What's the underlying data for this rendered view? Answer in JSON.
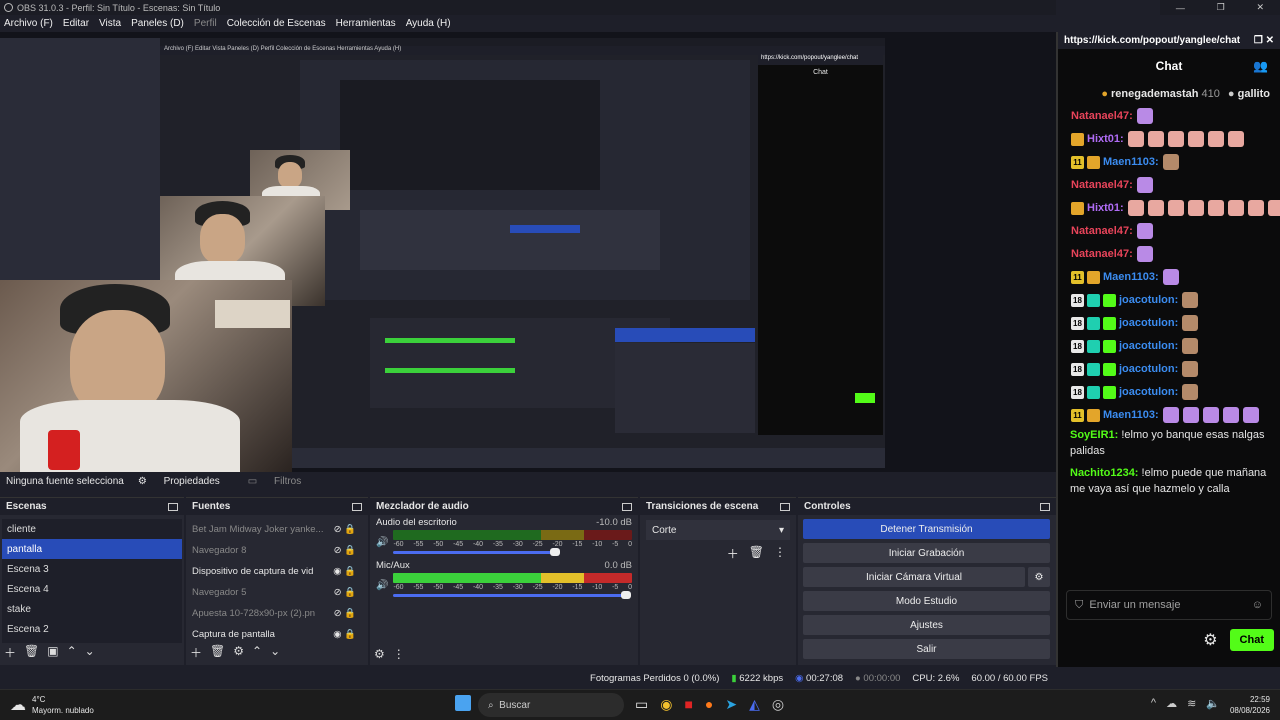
{
  "window": {
    "title": "OBS 31.0.3 - Perfil: Sin Título - Escenas: Sin Título"
  },
  "menu": [
    "Archivo (F)",
    "Editar",
    "Vista",
    "Paneles (D)",
    "Perfil",
    "Colección de Escenas",
    "Herramientas",
    "Ayuda (H)"
  ],
  "source_bar": {
    "label": "Ninguna fuente selecciona",
    "properties": "Propiedades",
    "filters": "Filtros"
  },
  "docks": {
    "scenes": {
      "title": "Escenas",
      "items": [
        "cliente",
        "pantalla",
        "Escena 3",
        "Escena 4",
        "stake",
        "Escena 2"
      ],
      "selected": "pantalla"
    },
    "sources": {
      "title": "Fuentes",
      "items": [
        "Bet Jam Midway Joker yanke...",
        "Navegador 8",
        "Dispositivo de captura de vid",
        "Navegador 5",
        "Apuesta 10-728x90-px (2).pn",
        "Captura de pantalla"
      ]
    },
    "mixer": {
      "title": "Mezclador de audio",
      "tracks": [
        {
          "name": "Audio del escritorio",
          "db": "-10.0 dB",
          "level": 0.55
        },
        {
          "name": "Mic/Aux",
          "db": "0.0 dB",
          "level": 0.99
        }
      ],
      "ticks": [
        "-60",
        "-55",
        "-50",
        "-45",
        "-40",
        "-35",
        "-30",
        "-25",
        "-20",
        "-15",
        "-10",
        "-5",
        "0"
      ]
    },
    "transitions": {
      "title": "Transiciones de escena",
      "selected": "Corte"
    },
    "controls": {
      "title": "Controles",
      "buttons": [
        "Detener Transmisión",
        "Iniciar Grabación",
        "Iniciar Cámara Virtual",
        "Modo Estudio",
        "Ajustes",
        "Salir"
      ]
    }
  },
  "status": {
    "dropped": "Fotogramas Perdidos 0 (0.0%)",
    "bitrate": "6222 kbps",
    "stream_time": "00:27:08",
    "rec_time": "00:00:00",
    "cpu": "CPU: 2.6%",
    "fps": "60.00 / 60.00 FPS"
  },
  "kick": {
    "url": "https://kick.com/popout/yanglee/chat",
    "title": "Chat",
    "top_gifters": [
      {
        "name": "renegademastah",
        "count": "410"
      },
      {
        "name": "gallito"
      }
    ],
    "messages": [
      {
        "user": "Natanael47",
        "color": "#e8445a",
        "badges": [],
        "emotes": [
          "purple"
        ]
      },
      {
        "user": "Hixt01",
        "color": "#b06cf5",
        "badges": [
          "crown"
        ],
        "emotes": [
          "pink",
          "pink",
          "pink",
          "pink",
          "pink",
          "pink"
        ]
      },
      {
        "user": "Maen1103",
        "color": "#3b8cf0",
        "badges": [
          "11",
          "crown"
        ],
        "emotes": [
          "face"
        ]
      },
      {
        "user": "Natanael47",
        "color": "#e8445a",
        "badges": [],
        "emotes": [
          "purple"
        ]
      },
      {
        "user": "Hixt01",
        "color": "#b06cf5",
        "badges": [
          "crown"
        ],
        "emotes": [
          "pink",
          "pink",
          "pink",
          "pink",
          "pink",
          "pink",
          "pink",
          "pink"
        ]
      },
      {
        "user": "Natanael47",
        "color": "#e8445a",
        "badges": [],
        "emotes": [
          "purple"
        ]
      },
      {
        "user": "Natanael47",
        "color": "#e8445a",
        "badges": [],
        "emotes": [
          "purple"
        ]
      },
      {
        "user": "Maen1103",
        "color": "#3b8cf0",
        "badges": [
          "11",
          "crown"
        ],
        "emotes": [
          "purple"
        ]
      },
      {
        "user": "joacotulon",
        "color": "#3b8cf0",
        "badges": [
          "18",
          "gift",
          "green"
        ],
        "emotes": [
          "face"
        ]
      },
      {
        "user": "joacotulon",
        "color": "#3b8cf0",
        "badges": [
          "18",
          "gift",
          "green"
        ],
        "emotes": [
          "face"
        ]
      },
      {
        "user": "joacotulon",
        "color": "#3b8cf0",
        "badges": [
          "18",
          "gift",
          "green"
        ],
        "emotes": [
          "face"
        ]
      },
      {
        "user": "joacotulon",
        "color": "#3b8cf0",
        "badges": [
          "18",
          "gift",
          "green"
        ],
        "emotes": [
          "face"
        ]
      },
      {
        "user": "joacotulon",
        "color": "#3b8cf0",
        "badges": [
          "18",
          "gift",
          "green"
        ],
        "emotes": [
          "face"
        ]
      },
      {
        "user": "Maen1103",
        "color": "#3b8cf0",
        "badges": [
          "11",
          "crown"
        ],
        "emotes": [
          "purple",
          "purple",
          "purple",
          "purple",
          "purple"
        ]
      }
    ],
    "text_messages": [
      {
        "user": "SoyEIR1",
        "color": "#53fc18",
        "text": "!elmo yo banque esas nalgas palidas"
      },
      {
        "user": "Nachito1234",
        "color": "#53fc18",
        "text": "!elmo puede que mañana me vaya así que hazmelo y calla"
      }
    ],
    "input_placeholder": "Enviar un mensaje",
    "send_label": "Chat"
  },
  "taskbar": {
    "temp": "4°C",
    "weather": "Mayorm. nublado",
    "search": "Buscar",
    "time": "22:59",
    "date": "08/08/2026"
  }
}
